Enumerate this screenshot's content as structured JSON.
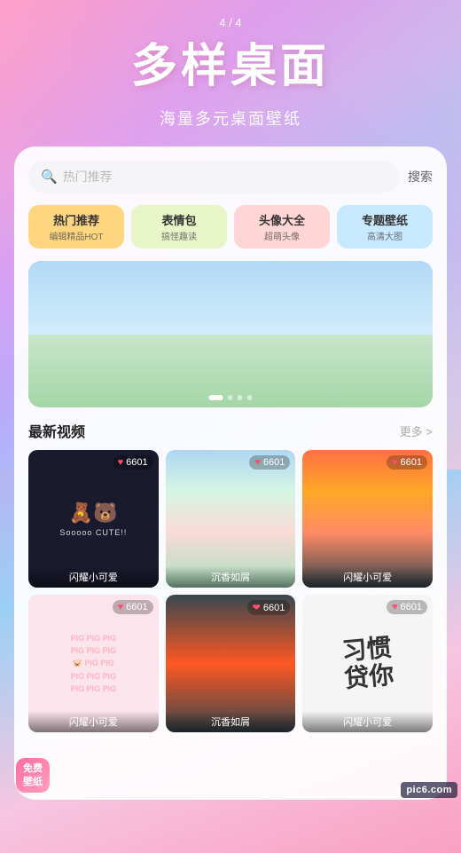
{
  "app": {
    "page_counter": "4 / 4",
    "main_title": "多样桌面",
    "sub_title": "海量多元桌面壁纸"
  },
  "search": {
    "placeholder": "热门推荐",
    "button_label": "搜索"
  },
  "categories": [
    {
      "label": "热门推荐",
      "sub": "编辑精品HOT",
      "active": true
    },
    {
      "label": "表情包",
      "sub": "搞怪趣读",
      "active": false
    },
    {
      "label": "头像大全",
      "sub": "超萌头像",
      "active": false
    },
    {
      "label": "专题壁纸",
      "sub": "高清大图",
      "active": false
    }
  ],
  "banner": {
    "dots": [
      true,
      false,
      false,
      false
    ]
  },
  "latest_videos": {
    "section_title": "最新视频",
    "more_label": "更多 >",
    "items": [
      {
        "likes": "6601",
        "label": "闪耀小可爱",
        "theme": "bears"
      },
      {
        "likes": "6601",
        "label": "沉香如屑",
        "theme": "tulips"
      },
      {
        "likes": "6601",
        "label": "闪耀小可爱",
        "theme": "sunset"
      },
      {
        "likes": "6601",
        "label": "闪耀小可爱",
        "theme": "pig"
      },
      {
        "likes": "6601",
        "label": "沉香如屑",
        "theme": "red-sky"
      },
      {
        "likes": "6601",
        "label": "闪耀小可爱",
        "theme": "calligraphy"
      }
    ]
  },
  "free_badge": {
    "line1": "免费",
    "line2": "壁纸"
  },
  "watermark": {
    "text": "pic6.com"
  },
  "icons": {
    "search": "🔍",
    "heart": "♥",
    "more_arrow": "›"
  }
}
